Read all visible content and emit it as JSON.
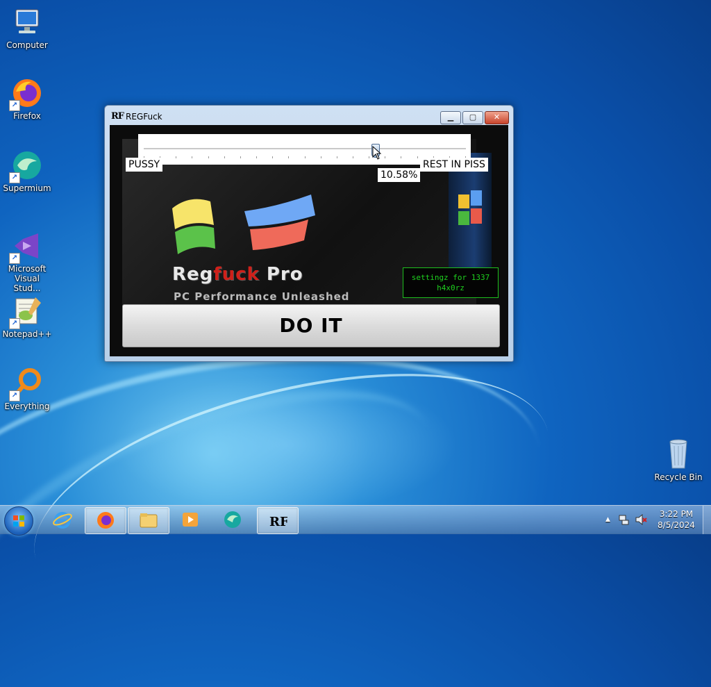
{
  "desktop": {
    "icons": [
      {
        "label": "Computer",
        "icon": "computer-icon"
      },
      {
        "label": "Firefox",
        "icon": "firefox-icon"
      },
      {
        "label": "Supermium",
        "icon": "supermium-icon"
      },
      {
        "label": "Microsoft Visual Stud...",
        "icon": "visual-studio-icon"
      },
      {
        "label": "Notepad++",
        "icon": "notepadpp-icon"
      },
      {
        "label": "Everything",
        "icon": "everything-icon"
      },
      {
        "label": "Recycle Bin",
        "icon": "recycle-bin-icon"
      }
    ]
  },
  "window": {
    "title": "REGFuck",
    "icon_text": "RF",
    "controls": {
      "minimize": "▁",
      "maximize": "▢",
      "close": "✕"
    },
    "slider": {
      "left_label": "PUSSY",
      "right_label": "REST IN PISS",
      "value_text": "10.58%",
      "value": 72
    },
    "boxart": {
      "brand_prefix": "Reg",
      "brand_red": "fuck",
      "brand_suffix": "Pro",
      "tagline": "PC Performance Unleashed"
    },
    "settings_button": "settingz for 1337 h4x0rz",
    "do_it_button": "DO IT"
  },
  "taskbar": {
    "items": [
      {
        "name": "internet-explorer",
        "icon": "ie-icon",
        "active": false
      },
      {
        "name": "firefox",
        "icon": "firefox-icon",
        "active": true
      },
      {
        "name": "explorer",
        "icon": "folder-icon",
        "active": true
      },
      {
        "name": "media-player",
        "icon": "media-player-icon",
        "active": false
      },
      {
        "name": "supermium",
        "icon": "supermium-icon",
        "active": false
      },
      {
        "name": "regfuck",
        "icon": "rf-icon",
        "active": true
      }
    ],
    "tray": {
      "show_hidden": "▲",
      "network": "network-icon",
      "volume": "volume-muted-icon"
    },
    "clock": {
      "time": "3:22 PM",
      "date": "8/5/2024"
    }
  },
  "colors": {
    "accent_green": "#1fd11f",
    "brand_red": "#d0201a",
    "desktop_blue": "#0f64c0"
  }
}
